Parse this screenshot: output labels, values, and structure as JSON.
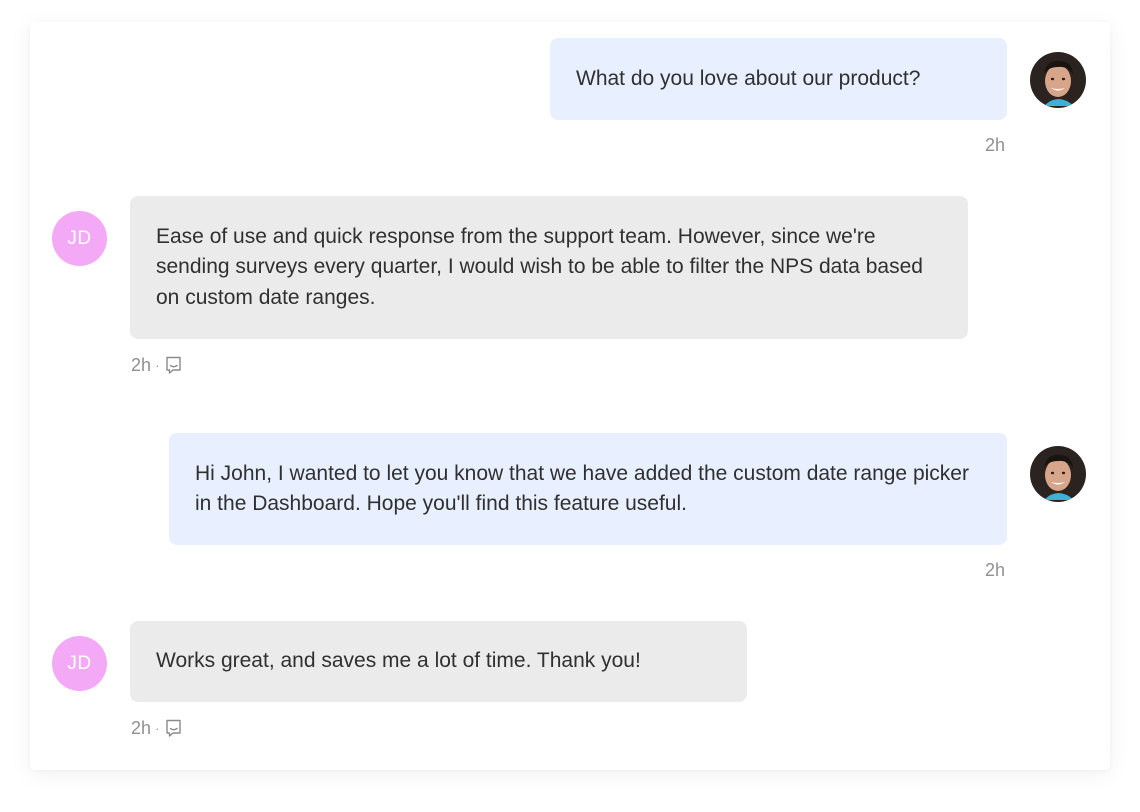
{
  "colors": {
    "agent_bubble": "#e8effe",
    "customer_bubble": "#ebebeb",
    "customer_avatar": "#f3a9f5",
    "timestamp_text": "#909090"
  },
  "messages": [
    {
      "sender": "agent",
      "avatar_icon": "agent-photo-avatar",
      "text": "What do you love about our product?",
      "time": "2h"
    },
    {
      "sender": "customer",
      "avatar_initials": "JD",
      "text": "Ease of use and quick response from the support team. However, since we're sending surveys every quarter, I would wish to be able to filter the NPS data based on custom date ranges.",
      "time": "2h",
      "separator": "·",
      "meta_icon": "feedback-icon"
    },
    {
      "sender": "agent",
      "avatar_icon": "agent-photo-avatar",
      "text": "Hi John, I wanted to let you know that we have added the custom date range picker in the Dashboard. Hope you'll find this feature useful.",
      "time": "2h"
    },
    {
      "sender": "customer",
      "avatar_initials": "JD",
      "text": "Works great, and saves me a lot of time. Thank you!",
      "time": "2h",
      "separator": "·",
      "meta_icon": "feedback-icon"
    }
  ]
}
